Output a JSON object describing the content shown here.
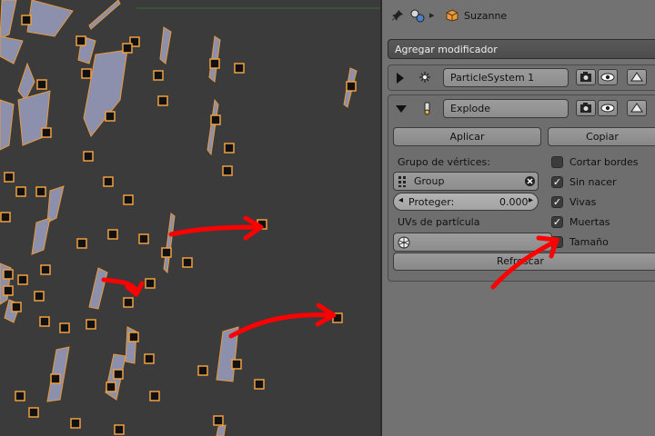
{
  "header": {
    "object_name": "Suzanne",
    "pin_icon": "pin-icon",
    "modifier_icon": "modifier-wrench-icon",
    "object_icon": "object-cube-icon"
  },
  "add_modifier": {
    "label": "Agregar modificador"
  },
  "modifiers": [
    {
      "name": "ParticleSystem 1",
      "expanded": false,
      "icon": "particles-icon"
    },
    {
      "name": "Explode",
      "expanded": true,
      "icon": "explode-icon"
    }
  ],
  "explode": {
    "apply_label": "Aplicar",
    "copy_label": "Copiar",
    "vertex_group_label": "Grupo de vértices:",
    "vertex_group_value": "Group",
    "protect_label": "Proteger:",
    "protect_value": "0.000",
    "particle_uv_label": "UVs de partícula",
    "particle_uv_value": "",
    "refresh_label": "Refrescar",
    "options": [
      {
        "label": "Cortar bordes",
        "checked": false
      },
      {
        "label": "Sin nacer",
        "checked": true
      },
      {
        "label": "Vivas",
        "checked": true
      },
      {
        "label": "Muertas",
        "checked": true
      },
      {
        "label": "Tamaño",
        "checked": false
      }
    ]
  },
  "colors": {
    "annotation_arrow": "#ff0000",
    "selection_orange": "#f0a040",
    "panel_bg": "#727272",
    "viewport_bg": "#3b3b3b"
  }
}
